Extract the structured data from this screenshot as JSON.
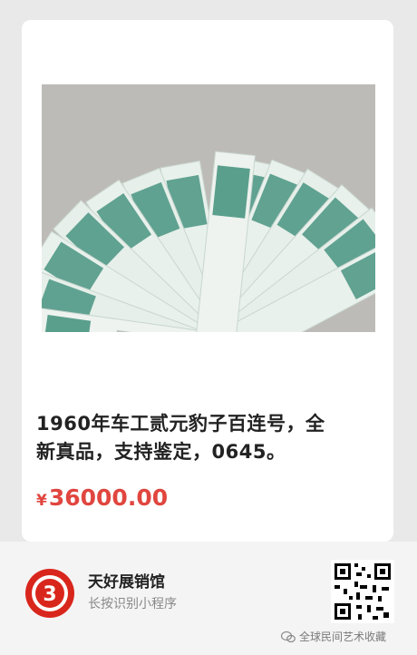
{
  "product": {
    "image_alt": "1960年车工贰元豹子百连号纸币扇形展开",
    "title_line1": "1960年车工贰元豹子百连号，全",
    "title_line2": "新真品，支持鉴定，0645。",
    "currency_symbol": "¥",
    "price": "36000.00"
  },
  "shop": {
    "name": "天好展销馆",
    "hint": "长按识别小程序",
    "logo_icon": "shop-logo-3-icon",
    "qr_icon": "mini-program-qr-icon"
  },
  "watermark": {
    "text": "全球民间艺术收藏",
    "icon": "wechat-icon"
  },
  "colors": {
    "price": "#e0463f",
    "logo_red": "#d9261c",
    "banknote_green": "#3f8f7a"
  }
}
